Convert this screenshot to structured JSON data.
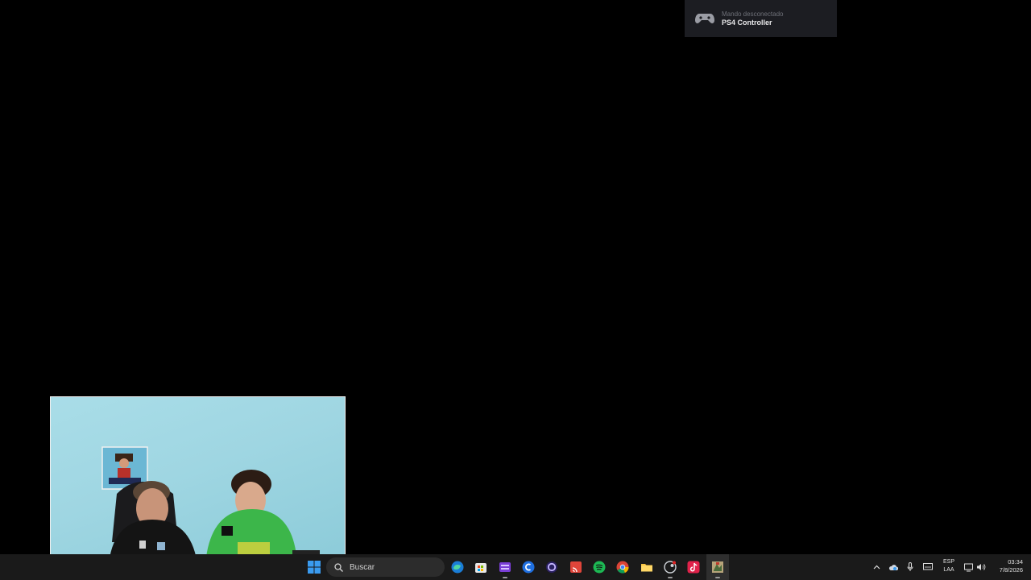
{
  "notification": {
    "subtitle": "Mando desconectado",
    "title": "PS4 Controller",
    "icon": "gamepad-icon"
  },
  "webcam": {
    "description_icon": "webcam-overlay"
  },
  "taskbar": {
    "search_placeholder": "Buscar",
    "apps": [
      {
        "name": "windows-start",
        "icon": "windows-logo-icon"
      },
      {
        "name": "edge",
        "icon": "edge-icon"
      },
      {
        "name": "store",
        "icon": "store-icon"
      },
      {
        "name": "clipchamp",
        "icon": "clipchamp-icon"
      },
      {
        "name": "copilot",
        "icon": "copilot-icon"
      },
      {
        "name": "cortana",
        "icon": "cortana-icon"
      },
      {
        "name": "cast",
        "icon": "cast-icon"
      },
      {
        "name": "spotify",
        "icon": "spotify-icon"
      },
      {
        "name": "chrome",
        "icon": "chrome-icon"
      },
      {
        "name": "file-explorer",
        "icon": "folder-icon"
      },
      {
        "name": "steam",
        "icon": "steam-icon"
      },
      {
        "name": "tiktok",
        "icon": "tiktok-icon"
      },
      {
        "name": "game",
        "icon": "game-icon"
      }
    ],
    "tray": {
      "language_line1": "ESP",
      "language_line2": "LAA",
      "time": "03:34",
      "date": "7/8/2026"
    }
  },
  "colors": {
    "background": "#000000",
    "taskbar": "#1a1a1a",
    "windows_blue": "#3a9bf0",
    "spotify_green": "#1db954",
    "tiktok_red": "#e0224a"
  }
}
